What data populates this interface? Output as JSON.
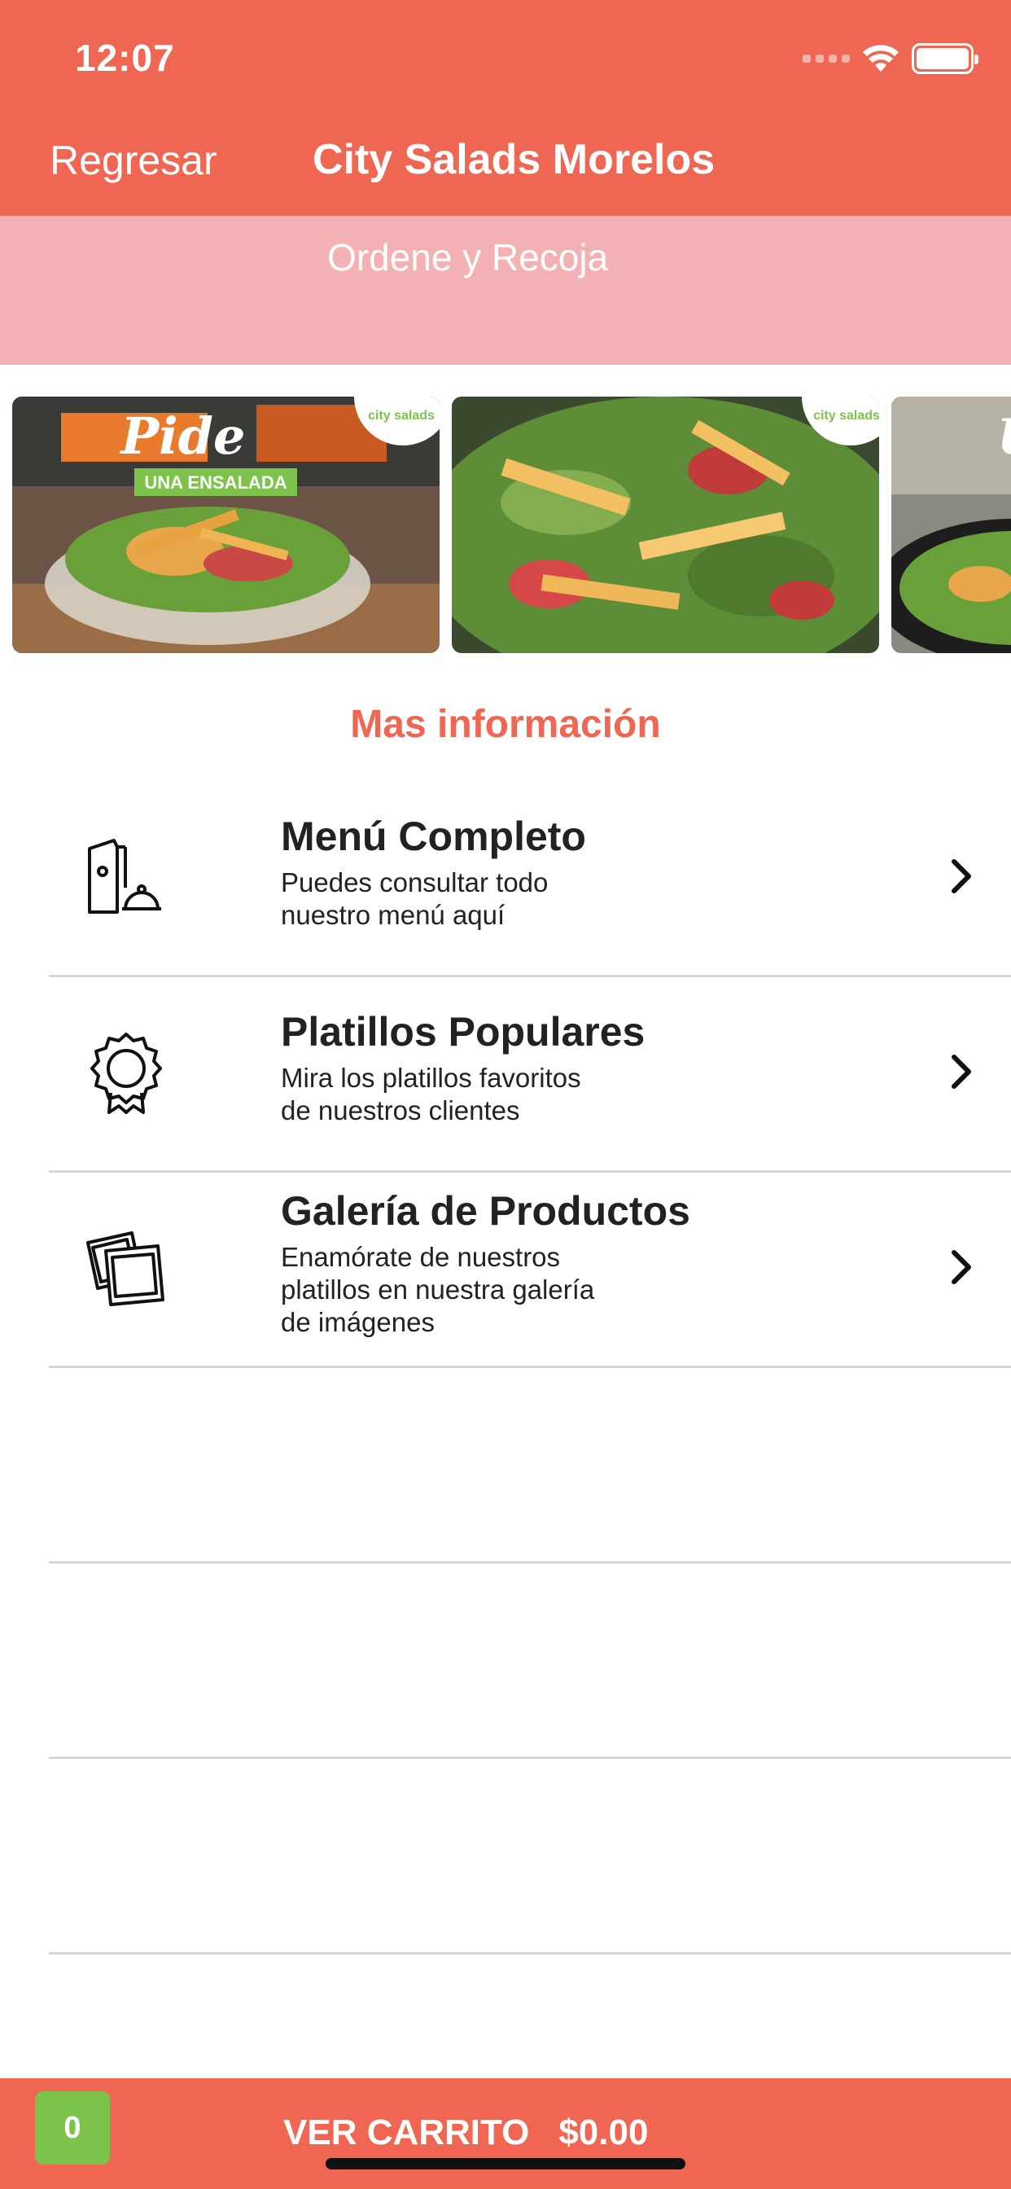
{
  "status_bar": {
    "time": "12:07"
  },
  "nav": {
    "back_label": "Regresar",
    "title": "City Salads Morelos"
  },
  "subheader": {
    "text": "Ordene y Recoja"
  },
  "carousel": {
    "slides": [
      {
        "headline": "Pide",
        "tagline": "UNA ENSALADA",
        "brand": "city salads"
      },
      {
        "brand": "city salads"
      },
      {
        "headline": "U"
      }
    ]
  },
  "section": {
    "title": "Mas información"
  },
  "info_items": [
    {
      "title": "Menú Completo",
      "desc": [
        "Puedes consultar todo",
        "nuestro menú aquí"
      ],
      "icon": "menu-icon"
    },
    {
      "title": "Platillos Populares",
      "desc": [
        "Mira los platillos favoritos",
        "de nuestros clientes"
      ],
      "icon": "award-icon"
    },
    {
      "title": "Galería de Productos",
      "desc": [
        "Enamórate de nuestros",
        "platillos en nuestra galería",
        "de imágenes"
      ],
      "icon": "gallery-icon"
    }
  ],
  "footer": {
    "cart_count": "0",
    "cart_label": "VER CARRITO",
    "cart_total": "$0.00"
  },
  "colors": {
    "primary": "#ef6652",
    "subheader": "#f4b1b3",
    "cart_badge": "#7dc24b"
  }
}
